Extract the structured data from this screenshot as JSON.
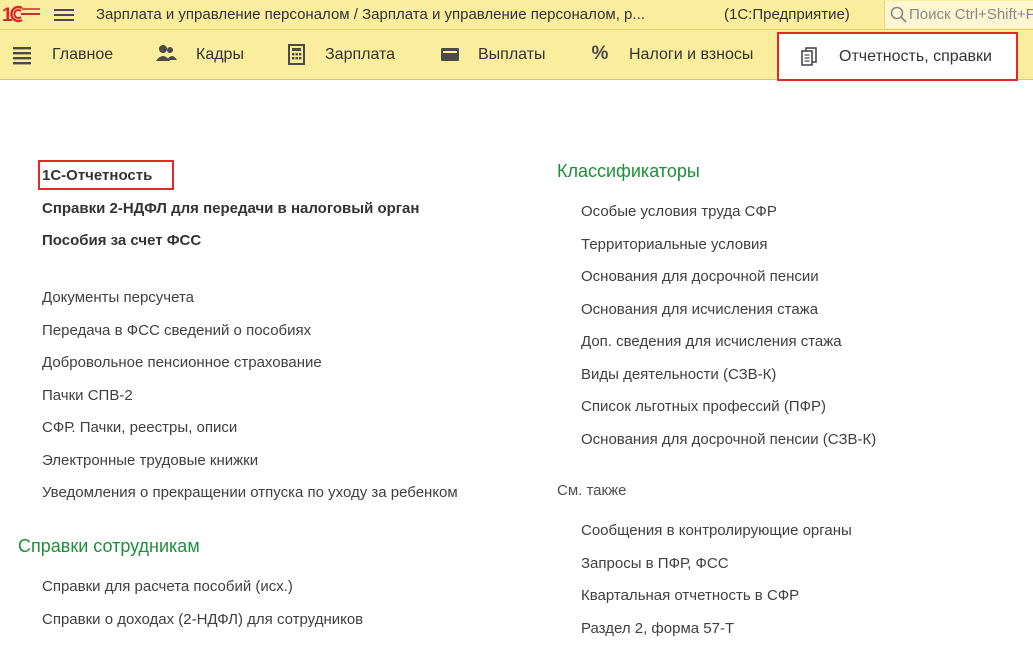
{
  "window": {
    "title": "Зарплата и управление персоналом / Зарплата и управление персоналом, р...",
    "mode": "(1С:Предприятие)",
    "search_placeholder": "Поиск Ctrl+Shift+F"
  },
  "sections": [
    {
      "label": "Главное",
      "icon": "list-icon"
    },
    {
      "label": "Кадры",
      "icon": "people-icon"
    },
    {
      "label": "Зарплата",
      "icon": "calculator-icon"
    },
    {
      "label": "Выплаты",
      "icon": "wallet-icon"
    },
    {
      "label": "Налоги и взносы",
      "icon": "percent-icon"
    },
    {
      "label": "Отчетность, справки",
      "icon": "documents-icon",
      "active": true
    }
  ],
  "left": {
    "main_links": [
      "1С-Отчетность",
      "Справки 2-НДФЛ для передачи в налоговый орган",
      "Пособия за счет ФСС"
    ],
    "links": [
      "Документы персучета",
      "Передача в ФСС сведений о пособиях",
      "Добровольное пенсионное страхование",
      "Пачки СПВ-2",
      "СФР. Пачки, реестры, описи",
      "Электронные трудовые книжки",
      "Уведомления о прекращении отпуска по уходу за ребенком"
    ],
    "employees_group": {
      "title": "Справки сотрудникам",
      "links": [
        "Справки для расчета пособий (исх.)",
        "Справки о доходах (2-НДФЛ) для сотрудников"
      ]
    }
  },
  "right": {
    "classifiers": {
      "title": "Классификаторы",
      "links": [
        "Особые условия труда СФР",
        "Территориальные условия",
        "Основания для досрочной пенсии",
        "Основания для исчисления стажа",
        "Доп. сведения для исчисления стажа",
        "Виды деятельности (СЗВ-К)",
        "Список льготных профессий (ПФР)",
        "Основания для досрочной пенсии (СЗВ-К)"
      ]
    },
    "see_also": {
      "title": "См. также",
      "links": [
        "Сообщения в контролирующие органы",
        "Запросы в ПФР, ФСС",
        "Квартальная отчетность в СФР",
        "Раздел 2, форма 57-Т"
      ]
    }
  },
  "colors": {
    "panel": "#fbed9e",
    "highlight": "#e02a2a",
    "group_title": "#1d8f3a",
    "logo": "#d8262b"
  }
}
